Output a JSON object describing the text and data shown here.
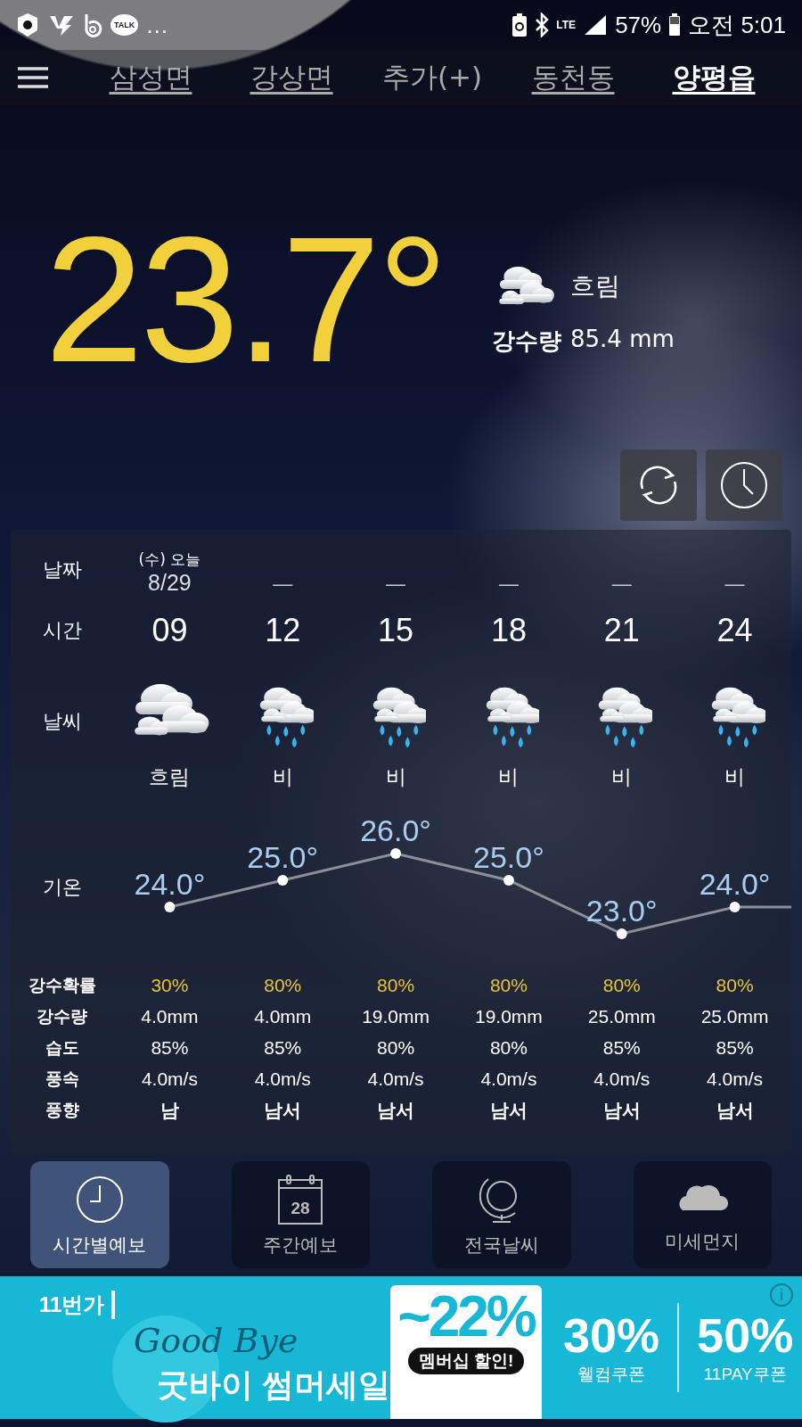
{
  "status_bar": {
    "talk_badge": "TALK",
    "more": "…",
    "network": "LTE",
    "battery": "57%",
    "time": "오전 5:01"
  },
  "location_tabs": [
    {
      "label": "삼성면",
      "kind": "place",
      "selected": false
    },
    {
      "label": "강상면",
      "kind": "place",
      "selected": false
    },
    {
      "label": "추가(+)",
      "kind": "add",
      "selected": false
    },
    {
      "label": "동천동",
      "kind": "place",
      "selected": false
    },
    {
      "label": "양평읍",
      "kind": "place",
      "selected": true
    }
  ],
  "current": {
    "temperature": "23.7°",
    "kind": "cloudy",
    "condition": "흐림",
    "precip_label": "강수량",
    "precip": "85.4 mm"
  },
  "forecast": {
    "row_labels": [
      "날짜",
      "시간",
      "날씨",
      "기온",
      "강수확률",
      "강수량",
      "습도",
      "풍속",
      "풍향"
    ],
    "columns": [
      {
        "day": "(수) 오늘",
        "date": "8/29",
        "time": "09",
        "temp": "24.0°",
        "kind": "cloudy",
        "condition": "흐림",
        "precip_prob": "30%",
        "precip": "4.0mm",
        "humidity": "85%",
        "wind_speed": "4.0m/s",
        "wind_dir": "남"
      },
      {
        "date": "—",
        "time": "12",
        "temp": "25.0°",
        "kind": "rain",
        "condition": "비",
        "precip_prob": "80%",
        "precip": "4.0mm",
        "humidity": "85%",
        "wind_speed": "4.0m/s",
        "wind_dir": "남서"
      },
      {
        "date": "—",
        "time": "15",
        "temp": "26.0°",
        "kind": "rain",
        "condition": "비",
        "precip_prob": "80%",
        "precip": "19.0mm",
        "humidity": "80%",
        "wind_speed": "4.0m/s",
        "wind_dir": "남서"
      },
      {
        "date": "—",
        "time": "18",
        "temp": "25.0°",
        "kind": "rain",
        "condition": "비",
        "precip_prob": "80%",
        "precip": "19.0mm",
        "humidity": "80%",
        "wind_speed": "4.0m/s",
        "wind_dir": "남서"
      },
      {
        "date": "—",
        "time": "21",
        "temp": "23.0°",
        "kind": "rain",
        "condition": "비",
        "precip_prob": "80%",
        "precip": "25.0mm",
        "humidity": "85%",
        "wind_speed": "4.0m/s",
        "wind_dir": "남서"
      },
      {
        "date": "—",
        "time": "24",
        "temp": "24.0°",
        "kind": "rain",
        "condition": "비",
        "precip_prob": "80%",
        "precip": "25.0mm",
        "humidity": "85%",
        "wind_speed": "4.0m/s",
        "wind_dir": "남서"
      }
    ]
  },
  "nav": [
    {
      "label": "시간별예보",
      "kind": "clock",
      "selected": true
    },
    {
      "label": "주간예보",
      "kind": "calendar",
      "icon_text": "28",
      "selected": false
    },
    {
      "label": "전국날씨",
      "kind": "globe",
      "selected": false
    },
    {
      "label": "미세먼지",
      "kind": "cloud",
      "selected": false
    }
  ],
  "ad": {
    "brand": "11번가",
    "script": "Good Bye",
    "headline": "굿바이 썸머세일",
    "discount": "~22%",
    "membership": "멤버십 할인!",
    "coupon1_value": "30%",
    "coupon1_label": "웰컴쿠폰",
    "coupon2_value": "50%",
    "coupon2_label": "11PAY쿠폰",
    "info": "i"
  }
}
